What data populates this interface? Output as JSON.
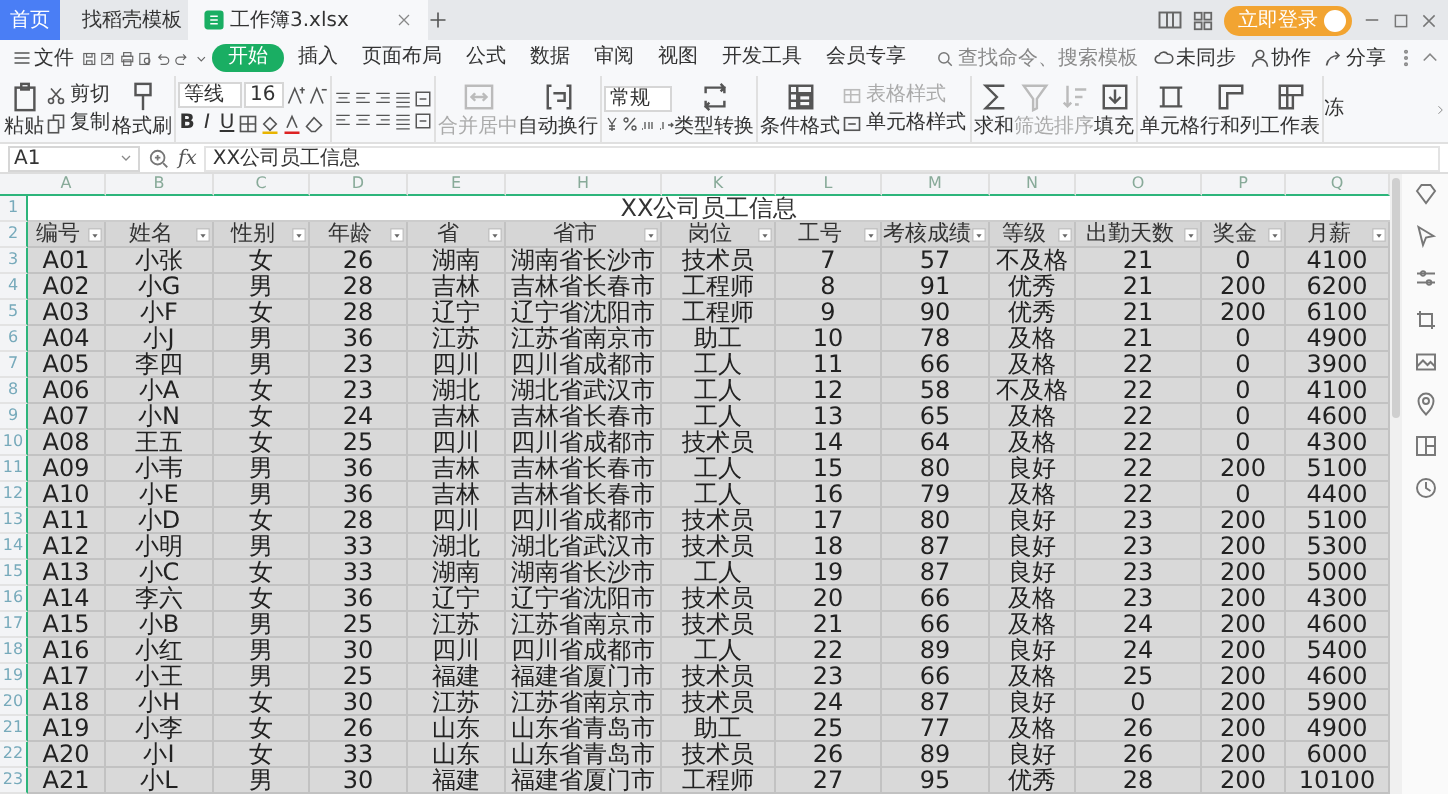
{
  "window": {
    "tabs": [
      {
        "label": "首页",
        "kind": "home",
        "selected": false
      },
      {
        "label": "找稻壳模板",
        "kind": "docer",
        "selected": false
      },
      {
        "label": "工作簿3.xlsx",
        "kind": "sheet",
        "selected": true
      }
    ],
    "login_button": "立即登录"
  },
  "menu": {
    "file": "文件",
    "tabs": [
      {
        "label": "开始",
        "selected": true
      },
      {
        "label": "插入",
        "selected": false
      },
      {
        "label": "页面布局",
        "selected": false
      },
      {
        "label": "公式",
        "selected": false
      },
      {
        "label": "数据",
        "selected": false
      },
      {
        "label": "审阅",
        "selected": false
      },
      {
        "label": "视图",
        "selected": false
      },
      {
        "label": "开发工具",
        "selected": false
      },
      {
        "label": "会员专享",
        "selected": false
      }
    ],
    "search": {
      "placeholder": "查找命令、搜索模板"
    },
    "actions": [
      "未同步",
      "协作",
      "分享"
    ]
  },
  "ribbon": {
    "paste": "粘贴",
    "cut": "剪切",
    "copy": "复制",
    "format_painter": "格式刷",
    "font_name": "等线",
    "font_size": "16",
    "style_buttons": [
      "B",
      "I",
      "U"
    ],
    "merge": {
      "label": "合并居中",
      "disabled": true
    },
    "wrap": {
      "label": "自动换行",
      "disabled": false
    },
    "number_format": "常规",
    "convert": "类型转换",
    "conditional_format": "条件格式",
    "table_style": {
      "label": "表格样式",
      "disabled": true
    },
    "cell_style": {
      "label": "单元格样式",
      "disabled": false
    },
    "tools": [
      {
        "label": "求和",
        "disabled": false
      },
      {
        "label": "筛选",
        "disabled": true
      },
      {
        "label": "排序",
        "disabled": true
      },
      {
        "label": "填充",
        "disabled": false
      }
    ],
    "structure": [
      "单元格",
      "行和列",
      "工作表"
    ],
    "cut_off": "冻"
  },
  "formula_bar": {
    "cell_ref": "A1",
    "fx": "fx",
    "value": "XX公司员工信息"
  },
  "sheet": {
    "columns": [
      "A",
      "B",
      "C",
      "D",
      "E",
      "H",
      "K",
      "L",
      "M",
      "N",
      "O",
      "P",
      "Q"
    ],
    "row_numbers": [
      "1",
      "2",
      "3",
      "4",
      "5",
      "6",
      "7",
      "8",
      "9",
      "10",
      "11",
      "12",
      "13",
      "14",
      "15",
      "16",
      "17",
      "18",
      "19",
      "20",
      "21",
      "22",
      "23"
    ],
    "title": "XX公司员工信息",
    "headers": [
      "编号",
      "姓名",
      "性别",
      "年龄",
      "省",
      "省市",
      "岗位",
      "工号",
      "考核成绩",
      "等级",
      "出勤天数",
      "奖金",
      "月薪"
    ],
    "rows": [
      [
        "A01",
        "小张",
        "女",
        "26",
        "湖南",
        "湖南省长沙市",
        "技术员",
        "7",
        "57",
        "不及格",
        "21",
        "0",
        "4100"
      ],
      [
        "A02",
        "小G",
        "男",
        "28",
        "吉林",
        "吉林省长春市",
        "工程师",
        "8",
        "91",
        "优秀",
        "21",
        "200",
        "6200"
      ],
      [
        "A03",
        "小F",
        "女",
        "28",
        "辽宁",
        "辽宁省沈阳市",
        "工程师",
        "9",
        "90",
        "优秀",
        "21",
        "200",
        "6100"
      ],
      [
        "A04",
        "小J",
        "男",
        "36",
        "江苏",
        "江苏省南京市",
        "助工",
        "10",
        "78",
        "及格",
        "21",
        "0",
        "4900"
      ],
      [
        "A05",
        "李四",
        "男",
        "23",
        "四川",
        "四川省成都市",
        "工人",
        "11",
        "66",
        "及格",
        "22",
        "0",
        "3900"
      ],
      [
        "A06",
        "小A",
        "女",
        "23",
        "湖北",
        "湖北省武汉市",
        "工人",
        "12",
        "58",
        "不及格",
        "22",
        "0",
        "4100"
      ],
      [
        "A07",
        "小N",
        "女",
        "24",
        "吉林",
        "吉林省长春市",
        "工人",
        "13",
        "65",
        "及格",
        "22",
        "0",
        "4600"
      ],
      [
        "A08",
        "王五",
        "女",
        "25",
        "四川",
        "四川省成都市",
        "技术员",
        "14",
        "64",
        "及格",
        "22",
        "0",
        "4300"
      ],
      [
        "A09",
        "小韦",
        "男",
        "36",
        "吉林",
        "吉林省长春市",
        "工人",
        "15",
        "80",
        "良好",
        "22",
        "200",
        "5100"
      ],
      [
        "A10",
        "小E",
        "男",
        "36",
        "吉林",
        "吉林省长春市",
        "工人",
        "16",
        "79",
        "及格",
        "22",
        "0",
        "4400"
      ],
      [
        "A11",
        "小D",
        "女",
        "28",
        "四川",
        "四川省成都市",
        "技术员",
        "17",
        "80",
        "良好",
        "23",
        "200",
        "5100"
      ],
      [
        "A12",
        "小明",
        "男",
        "33",
        "湖北",
        "湖北省武汉市",
        "技术员",
        "18",
        "87",
        "良好",
        "23",
        "200",
        "5300"
      ],
      [
        "A13",
        "小C",
        "女",
        "33",
        "湖南",
        "湖南省长沙市",
        "工人",
        "19",
        "87",
        "良好",
        "23",
        "200",
        "5000"
      ],
      [
        "A14",
        "李六",
        "女",
        "36",
        "辽宁",
        "辽宁省沈阳市",
        "技术员",
        "20",
        "66",
        "及格",
        "23",
        "200",
        "4300"
      ],
      [
        "A15",
        "小B",
        "男",
        "25",
        "江苏",
        "江苏省南京市",
        "技术员",
        "21",
        "66",
        "及格",
        "24",
        "200",
        "4600"
      ],
      [
        "A16",
        "小红",
        "男",
        "30",
        "四川",
        "四川省成都市",
        "工人",
        "22",
        "89",
        "良好",
        "24",
        "200",
        "5400"
      ],
      [
        "A17",
        "小王",
        "男",
        "25",
        "福建",
        "福建省厦门市",
        "技术员",
        "23",
        "66",
        "及格",
        "25",
        "200",
        "4600"
      ],
      [
        "A18",
        "小H",
        "女",
        "30",
        "江苏",
        "江苏省南京市",
        "技术员",
        "24",
        "87",
        "良好",
        "0",
        "200",
        "5900"
      ],
      [
        "A19",
        "小李",
        "女",
        "26",
        "山东",
        "山东省青岛市",
        "助工",
        "25",
        "77",
        "及格",
        "26",
        "200",
        "4900"
      ],
      [
        "A20",
        "小I",
        "女",
        "33",
        "山东",
        "山东省青岛市",
        "技术员",
        "26",
        "89",
        "良好",
        "26",
        "200",
        "6000"
      ],
      [
        "A21",
        "小L",
        "男",
        "30",
        "福建",
        "福建省厦门市",
        "工程师",
        "27",
        "95",
        "优秀",
        "28",
        "200",
        "10100"
      ]
    ]
  }
}
